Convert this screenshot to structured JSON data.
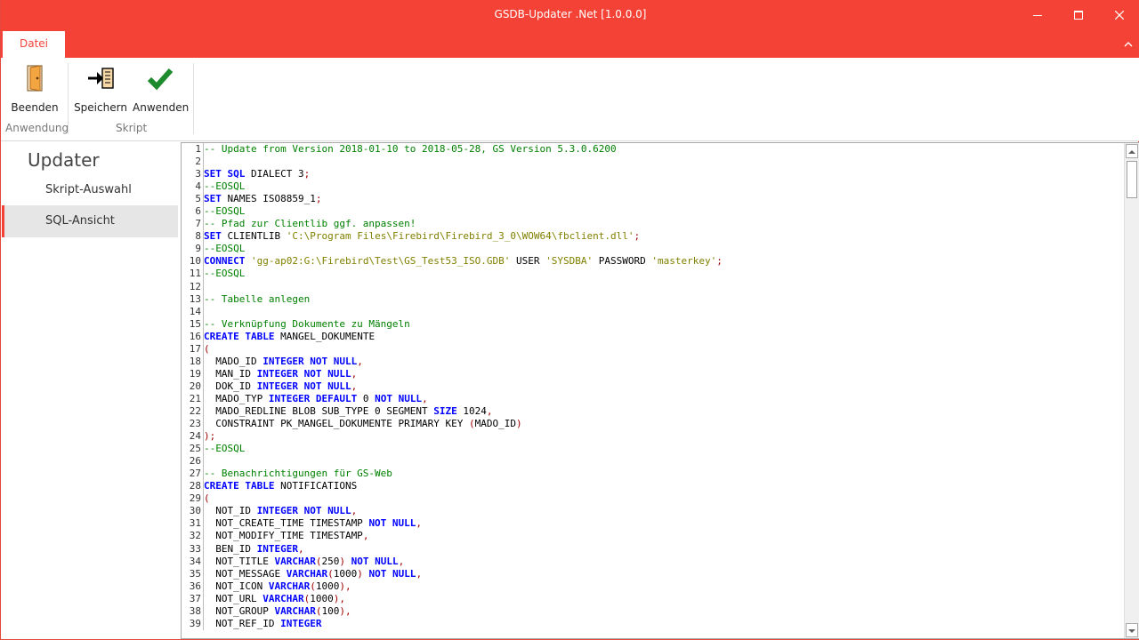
{
  "window": {
    "title": "GSDB-Updater .Net [1.0.0.0]",
    "accent_color": "#f44336"
  },
  "ribbon": {
    "tab_label": "Datei",
    "buttons": {
      "beenden": "Beenden",
      "speichern": "Speichern",
      "anwenden": "Anwenden"
    },
    "groups": {
      "anwendung": "Anwendung",
      "skript": "Skript"
    }
  },
  "sidenav": {
    "title": "Updater",
    "items": [
      {
        "label": "Skript-Auswahl",
        "selected": false
      },
      {
        "label": "SQL-Ansicht",
        "selected": true
      }
    ]
  },
  "editor": {
    "lines": [
      [
        [
          "c",
          "-- Update from Version 2018-01-10 to 2018-05-28, GS Version 5.3.0.6200"
        ]
      ],
      [],
      [
        [
          "k",
          "SET SQL"
        ],
        [
          "t",
          " DIALECT 3"
        ],
        [
          "p",
          ";"
        ]
      ],
      [
        [
          "c",
          "--EOSQL"
        ]
      ],
      [
        [
          "k",
          "SET"
        ],
        [
          "t",
          " NAMES ISO8859_1"
        ],
        [
          "p",
          ";"
        ]
      ],
      [
        [
          "c",
          "--EOSQL"
        ]
      ],
      [
        [
          "c",
          "-- Pfad zur Clientlib ggf. anpassen!"
        ]
      ],
      [
        [
          "k",
          "SET"
        ],
        [
          "t",
          " CLIENTLIB "
        ],
        [
          "s",
          "'C:\\Program Files\\Firebird\\Firebird_3_0\\WOW64\\fbclient.dll'"
        ],
        [
          "p",
          ";"
        ]
      ],
      [
        [
          "c",
          "--EOSQL"
        ]
      ],
      [
        [
          "k",
          "CONNECT"
        ],
        [
          "t",
          " "
        ],
        [
          "s",
          "'gg-ap02:G:\\Firebird\\Test\\GS_Test53_ISO.GDB'"
        ],
        [
          "t",
          " USER "
        ],
        [
          "s",
          "'SYSDBA'"
        ],
        [
          "t",
          " PASSWORD "
        ],
        [
          "s",
          "'masterkey'"
        ],
        [
          "p",
          ";"
        ]
      ],
      [
        [
          "c",
          "--EOSQL"
        ]
      ],
      [],
      [
        [
          "c",
          "-- Tabelle anlegen"
        ]
      ],
      [],
      [
        [
          "c",
          "-- Verknüpfung Dokumente zu Mängeln"
        ]
      ],
      [
        [
          "k",
          "CREATE TABLE"
        ],
        [
          "t",
          " MANGEL_DOKUMENTE"
        ]
      ],
      [
        [
          "p",
          "("
        ]
      ],
      [
        [
          "t",
          "  MADO_ID "
        ],
        [
          "k",
          "INTEGER NOT NULL"
        ],
        [
          "p",
          ","
        ]
      ],
      [
        [
          "t",
          "  MAN_ID "
        ],
        [
          "k",
          "INTEGER NOT NULL"
        ],
        [
          "p",
          ","
        ]
      ],
      [
        [
          "t",
          "  DOK_ID "
        ],
        [
          "k",
          "INTEGER NOT NULL"
        ],
        [
          "p",
          ","
        ]
      ],
      [
        [
          "t",
          "  MADO_TYP "
        ],
        [
          "k",
          "INTEGER DEFAULT"
        ],
        [
          "t",
          " 0 "
        ],
        [
          "k",
          "NOT NULL"
        ],
        [
          "p",
          ","
        ]
      ],
      [
        [
          "t",
          "  MADO_REDLINE BLOB SUB_TYPE 0 SEGMENT "
        ],
        [
          "k",
          "SIZE"
        ],
        [
          "t",
          " 1024"
        ],
        [
          "p",
          ","
        ]
      ],
      [
        [
          "t",
          "  CONSTRAINT PK_MANGEL_DOKUMENTE PRIMARY KEY "
        ],
        [
          "p",
          "("
        ],
        [
          "t",
          "MADO_ID"
        ],
        [
          "p",
          ")"
        ]
      ],
      [
        [
          "p",
          ");"
        ]
      ],
      [
        [
          "c",
          "--EOSQL"
        ]
      ],
      [],
      [
        [
          "c",
          "-- Benachrichtigungen für GS-Web"
        ]
      ],
      [
        [
          "k",
          "CREATE TABLE"
        ],
        [
          "t",
          " NOTIFICATIONS"
        ]
      ],
      [
        [
          "p",
          "("
        ]
      ],
      [
        [
          "t",
          "  NOT_ID "
        ],
        [
          "k",
          "INTEGER NOT NULL"
        ],
        [
          "p",
          ","
        ]
      ],
      [
        [
          "t",
          "  NOT_CREATE_TIME TIMESTAMP "
        ],
        [
          "k",
          "NOT NULL"
        ],
        [
          "p",
          ","
        ]
      ],
      [
        [
          "t",
          "  NOT_MODIFY_TIME TIMESTAMP"
        ],
        [
          "p",
          ","
        ]
      ],
      [
        [
          "t",
          "  BEN_ID "
        ],
        [
          "k",
          "INTEGER"
        ],
        [
          "p",
          ","
        ]
      ],
      [
        [
          "t",
          "  NOT_TITLE "
        ],
        [
          "k",
          "VARCHAR"
        ],
        [
          "p",
          "("
        ],
        [
          "t",
          "250"
        ],
        [
          "p",
          ")"
        ],
        [
          "t",
          " "
        ],
        [
          "k",
          "NOT NULL"
        ],
        [
          "p",
          ","
        ]
      ],
      [
        [
          "t",
          "  NOT_MESSAGE "
        ],
        [
          "k",
          "VARCHAR"
        ],
        [
          "p",
          "("
        ],
        [
          "t",
          "1000"
        ],
        [
          "p",
          ")"
        ],
        [
          "t",
          " "
        ],
        [
          "k",
          "NOT NULL"
        ],
        [
          "p",
          ","
        ]
      ],
      [
        [
          "t",
          "  NOT_ICON "
        ],
        [
          "k",
          "VARCHAR"
        ],
        [
          "p",
          "("
        ],
        [
          "t",
          "1000"
        ],
        [
          "p",
          "),"
        ]
      ],
      [
        [
          "t",
          "  NOT_URL "
        ],
        [
          "k",
          "VARCHAR"
        ],
        [
          "p",
          "("
        ],
        [
          "t",
          "1000"
        ],
        [
          "p",
          "),"
        ]
      ],
      [
        [
          "t",
          "  NOT_GROUP "
        ],
        [
          "k",
          "VARCHAR"
        ],
        [
          "p",
          "("
        ],
        [
          "t",
          "100"
        ],
        [
          "p",
          "),"
        ]
      ],
      [
        [
          "t",
          "  NOT_REF_ID "
        ],
        [
          "k",
          "INTEGER"
        ]
      ]
    ]
  }
}
